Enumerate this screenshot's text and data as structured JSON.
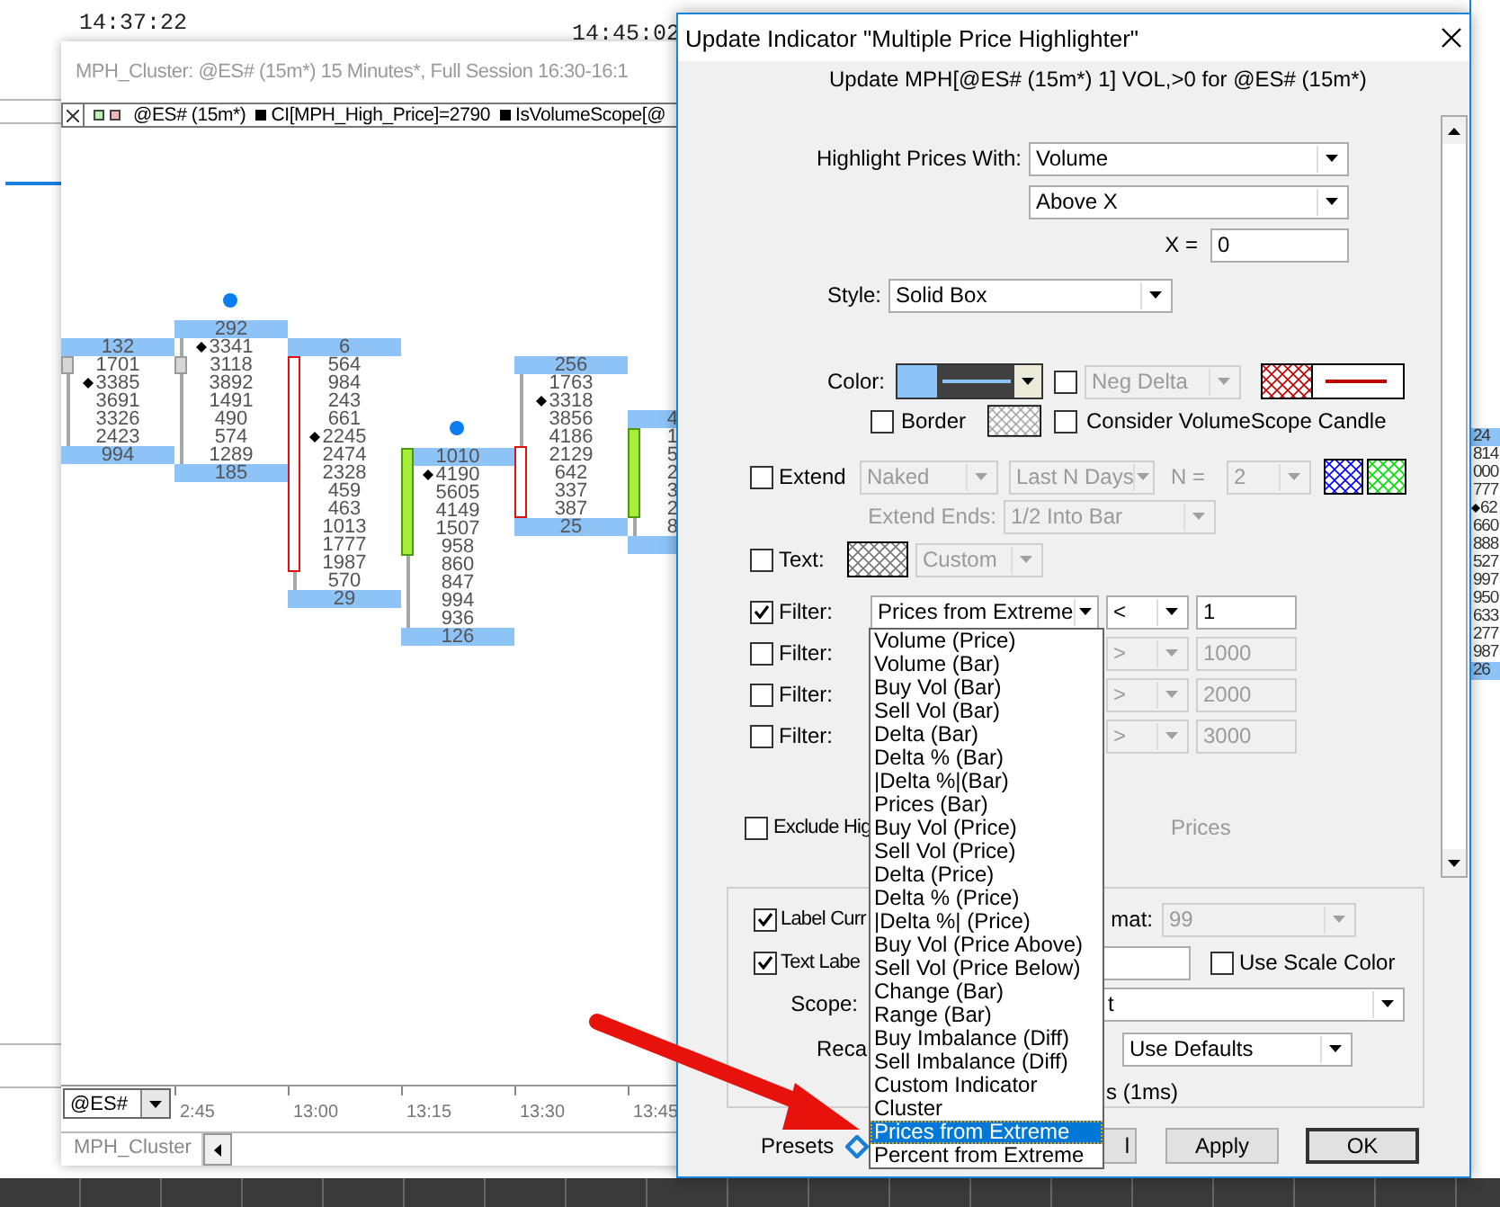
{
  "background": {
    "times": [
      "14:37:22",
      "14:45:02"
    ],
    "side_values": [
      {
        "value": "24",
        "highlighted": true,
        "marked": false
      },
      {
        "value": "814",
        "highlighted": false,
        "marked": false
      },
      {
        "value": "000",
        "highlighted": false,
        "marked": false
      },
      {
        "value": "777",
        "highlighted": false,
        "marked": false
      },
      {
        "value": "62",
        "highlighted": false,
        "marked": true
      },
      {
        "value": "660",
        "highlighted": false,
        "marked": false
      },
      {
        "value": "888",
        "highlighted": false,
        "marked": false
      },
      {
        "value": "527",
        "highlighted": false,
        "marked": false
      },
      {
        "value": "997",
        "highlighted": false,
        "marked": false
      },
      {
        "value": "950",
        "highlighted": false,
        "marked": false
      },
      {
        "value": "633",
        "highlighted": false,
        "marked": false
      },
      {
        "value": "277",
        "highlighted": false,
        "marked": false
      },
      {
        "value": "987",
        "highlighted": false,
        "marked": false
      },
      {
        "value": "26",
        "highlighted": true,
        "marked": false
      }
    ]
  },
  "chart_window": {
    "title": "MPH_Cluster: @ES# (15m*) 15 Minutes*, Full Session 16:30-16:1",
    "legend": {
      "symbol": "@ES# (15m*)",
      "items": [
        "CI[MPH_High_Price]=2790",
        "IsVolumeScope[@"
      ]
    },
    "clusters": [
      {
        "kind": "flat",
        "signal": false,
        "rows": [
          {
            "value": "132",
            "highlighted": true,
            "marked": false,
            "in_body": false
          },
          {
            "value": "1701",
            "highlighted": false,
            "marked": false,
            "in_body": true
          },
          {
            "value": "3385",
            "highlighted": false,
            "marked": true,
            "in_body": false
          },
          {
            "value": "3691",
            "highlighted": false,
            "marked": false,
            "in_body": false
          },
          {
            "value": "3326",
            "highlighted": false,
            "marked": false,
            "in_body": false
          },
          {
            "value": "2423",
            "highlighted": false,
            "marked": false,
            "in_body": false
          },
          {
            "value": "994",
            "highlighted": true,
            "marked": false,
            "in_body": false
          }
        ]
      },
      {
        "kind": "flat",
        "signal": true,
        "rows": [
          {
            "value": "292",
            "highlighted": true,
            "marked": false,
            "in_body": false
          },
          {
            "value": "3341",
            "highlighted": false,
            "marked": true,
            "in_body": false
          },
          {
            "value": "3118",
            "highlighted": false,
            "marked": false,
            "in_body": true
          },
          {
            "value": "3892",
            "highlighted": false,
            "marked": false,
            "in_body": false
          },
          {
            "value": "1491",
            "highlighted": false,
            "marked": false,
            "in_body": false
          },
          {
            "value": "490",
            "highlighted": false,
            "marked": false,
            "in_body": false
          },
          {
            "value": "574",
            "highlighted": false,
            "marked": false,
            "in_body": false
          },
          {
            "value": "1289",
            "highlighted": false,
            "marked": false,
            "in_body": false
          },
          {
            "value": "185",
            "highlighted": true,
            "marked": false,
            "in_body": false
          }
        ]
      },
      {
        "kind": "bear",
        "signal": false,
        "rows": [
          {
            "value": "6",
            "highlighted": true,
            "marked": false,
            "in_body": false
          },
          {
            "value": "564",
            "highlighted": false,
            "marked": false,
            "in_body": true
          },
          {
            "value": "984",
            "highlighted": false,
            "marked": false,
            "in_body": true
          },
          {
            "value": "243",
            "highlighted": false,
            "marked": false,
            "in_body": true
          },
          {
            "value": "661",
            "highlighted": false,
            "marked": false,
            "in_body": true
          },
          {
            "value": "2245",
            "highlighted": false,
            "marked": true,
            "in_body": true
          },
          {
            "value": "2474",
            "highlighted": false,
            "marked": false,
            "in_body": true
          },
          {
            "value": "2328",
            "highlighted": false,
            "marked": false,
            "in_body": true
          },
          {
            "value": "459",
            "highlighted": false,
            "marked": false,
            "in_body": true
          },
          {
            "value": "463",
            "highlighted": false,
            "marked": false,
            "in_body": true
          },
          {
            "value": "1013",
            "highlighted": false,
            "marked": false,
            "in_body": true
          },
          {
            "value": "1777",
            "highlighted": false,
            "marked": false,
            "in_body": true
          },
          {
            "value": "1987",
            "highlighted": false,
            "marked": false,
            "in_body": true
          },
          {
            "value": "570",
            "highlighted": false,
            "marked": false,
            "in_body": false
          },
          {
            "value": "29",
            "highlighted": true,
            "marked": false,
            "in_body": false
          }
        ]
      },
      {
        "kind": "bull",
        "signal": true,
        "rows": [
          {
            "value": "1010",
            "highlighted": true,
            "marked": false,
            "in_body": true
          },
          {
            "value": "4190",
            "highlighted": false,
            "marked": true,
            "in_body": true
          },
          {
            "value": "5605",
            "highlighted": false,
            "marked": false,
            "in_body": true
          },
          {
            "value": "4149",
            "highlighted": false,
            "marked": false,
            "in_body": true
          },
          {
            "value": "1507",
            "highlighted": false,
            "marked": false,
            "in_body": true
          },
          {
            "value": "958",
            "highlighted": false,
            "marked": false,
            "in_body": true
          },
          {
            "value": "860",
            "highlighted": false,
            "marked": false,
            "in_body": false
          },
          {
            "value": "847",
            "highlighted": false,
            "marked": false,
            "in_body": false
          },
          {
            "value": "994",
            "highlighted": false,
            "marked": false,
            "in_body": false
          },
          {
            "value": "936",
            "highlighted": false,
            "marked": false,
            "in_body": false
          },
          {
            "value": "126",
            "highlighted": true,
            "marked": false,
            "in_body": false
          }
        ]
      },
      {
        "kind": "bear",
        "signal": false,
        "rows": [
          {
            "value": "256",
            "highlighted": true,
            "marked": false,
            "in_body": false
          },
          {
            "value": "1763",
            "highlighted": false,
            "marked": false,
            "in_body": false
          },
          {
            "value": "3318",
            "highlighted": false,
            "marked": true,
            "in_body": false
          },
          {
            "value": "3856",
            "highlighted": false,
            "marked": false,
            "in_body": false
          },
          {
            "value": "4186",
            "highlighted": false,
            "marked": false,
            "in_body": false
          },
          {
            "value": "2129",
            "highlighted": false,
            "marked": false,
            "in_body": true
          },
          {
            "value": "642",
            "highlighted": false,
            "marked": false,
            "in_body": true
          },
          {
            "value": "337",
            "highlighted": false,
            "marked": false,
            "in_body": true
          },
          {
            "value": "387",
            "highlighted": false,
            "marked": false,
            "in_body": true
          },
          {
            "value": "25",
            "highlighted": true,
            "marked": false,
            "in_body": false
          }
        ]
      },
      {
        "kind": "bull",
        "signal": false,
        "rows": [
          {
            "value": "4",
            "highlighted": true,
            "marked": false,
            "in_body": false
          },
          {
            "value": "1",
            "highlighted": false,
            "marked": false,
            "in_body": true
          },
          {
            "value": "5",
            "highlighted": false,
            "marked": false,
            "in_body": true
          },
          {
            "value": "2",
            "highlighted": false,
            "marked": false,
            "in_body": true
          },
          {
            "value": "3",
            "highlighted": false,
            "marked": false,
            "in_body": true
          },
          {
            "value": "2",
            "highlighted": false,
            "marked": false,
            "in_body": true
          },
          {
            "value": "8",
            "highlighted": false,
            "marked": false,
            "in_body": false
          },
          {
            "highlighted": true,
            "marked": false,
            "in_body": false
          }
        ]
      }
    ],
    "time_axis": [
      "2:45",
      "13:00",
      "13:15",
      "13:30",
      "13:45"
    ],
    "symbol_select": "@ES#",
    "sheet_tab": "MPH_Cluster"
  },
  "dialog": {
    "title": "Update Indicator \"Multiple Price Highlighter\"",
    "subtitle": "Update MPH[@ES# (15m*) 1] VOL,>0 for @ES# (15m*)",
    "highlight_label": "Highlight Prices With:",
    "highlight_source": "Volume",
    "highlight_condition": "Above X",
    "x_label": "X =",
    "x_value": "0",
    "style_label": "Style:",
    "style": "Solid Box",
    "color_label": "Color:",
    "neg_delta": {
      "checked": false,
      "value": "Neg Delta"
    },
    "border": {
      "label": "Border",
      "checked": false
    },
    "consider_candle": {
      "label": "Consider VolumeScope Candle",
      "checked": false
    },
    "extend": {
      "label": "Extend",
      "checked": false,
      "mode": "Naked",
      "range": "Last N Days",
      "n_label": "N =",
      "n": "2",
      "ends_label": "Extend Ends:",
      "ends": "1/2 Into Bar"
    },
    "text": {
      "label": "Text:",
      "checked": false,
      "value": "Custom"
    },
    "filters": [
      {
        "label": "Filter:",
        "checked": true,
        "field": "Prices from Extreme",
        "operator": "<",
        "value": "1"
      },
      {
        "label": "Filter:",
        "checked": false,
        "operator": ">",
        "value": "1000"
      },
      {
        "label": "Filter:",
        "checked": false,
        "operator": ">",
        "value": "2000"
      },
      {
        "label": "Filter:",
        "checked": false,
        "operator": ">",
        "value": "3000"
      }
    ],
    "exclude": {
      "label": "Exclude Hig",
      "checked": false,
      "unit": "Prices"
    },
    "label_current": {
      "label": "Label Curr",
      "checked": true
    },
    "format_label": "mat:",
    "format": {
      "value": "99",
      "disabled": true
    },
    "text_label": {
      "label": "Text Labe",
      "checked": true
    },
    "use_scale_color": {
      "label": "Use Scale Color",
      "checked": false
    },
    "scope_label": "Scope:",
    "scope": "t",
    "recalc_label": "Reca",
    "recalc": "Use Defaults",
    "recalc_note": "s (1ms)",
    "presets_label": "Presets",
    "buttons": [
      {
        "label": "l",
        "focused": false
      },
      {
        "label": "Apply",
        "focused": false
      },
      {
        "label": "OK",
        "focused": true
      }
    ],
    "dropdown": [
      {
        "label": "Volume (Price)",
        "selected": false
      },
      {
        "label": "Volume (Bar)",
        "selected": false
      },
      {
        "label": "Buy Vol (Bar)",
        "selected": false
      },
      {
        "label": "Sell Vol (Bar)",
        "selected": false
      },
      {
        "label": "Delta (Bar)",
        "selected": false
      },
      {
        "label": "Delta % (Bar)",
        "selected": false
      },
      {
        "label": "|Delta %|(Bar)",
        "selected": false
      },
      {
        "label": "Prices (Bar)",
        "selected": false
      },
      {
        "label": "Buy Vol (Price)",
        "selected": false
      },
      {
        "label": "Sell Vol (Price)",
        "selected": false
      },
      {
        "label": "Delta (Price)",
        "selected": false
      },
      {
        "label": "Delta % (Price)",
        "selected": false
      },
      {
        "label": "|Delta %| (Price)",
        "selected": false
      },
      {
        "label": "Buy Vol (Price Above)",
        "selected": false
      },
      {
        "label": "Sell Vol (Price Below)",
        "selected": false
      },
      {
        "label": "Change (Bar)",
        "selected": false
      },
      {
        "label": "Range (Bar)",
        "selected": false
      },
      {
        "label": "Buy Imbalance (Diff)",
        "selected": false
      },
      {
        "label": "Sell Imbalance (Diff)",
        "selected": false
      },
      {
        "label": "Custom Indicator",
        "selected": false
      },
      {
        "label": "Cluster",
        "selected": false
      },
      {
        "label": "Prices from Extreme",
        "selected": true
      },
      {
        "label": "Percent from Extreme",
        "selected": false
      }
    ]
  }
}
